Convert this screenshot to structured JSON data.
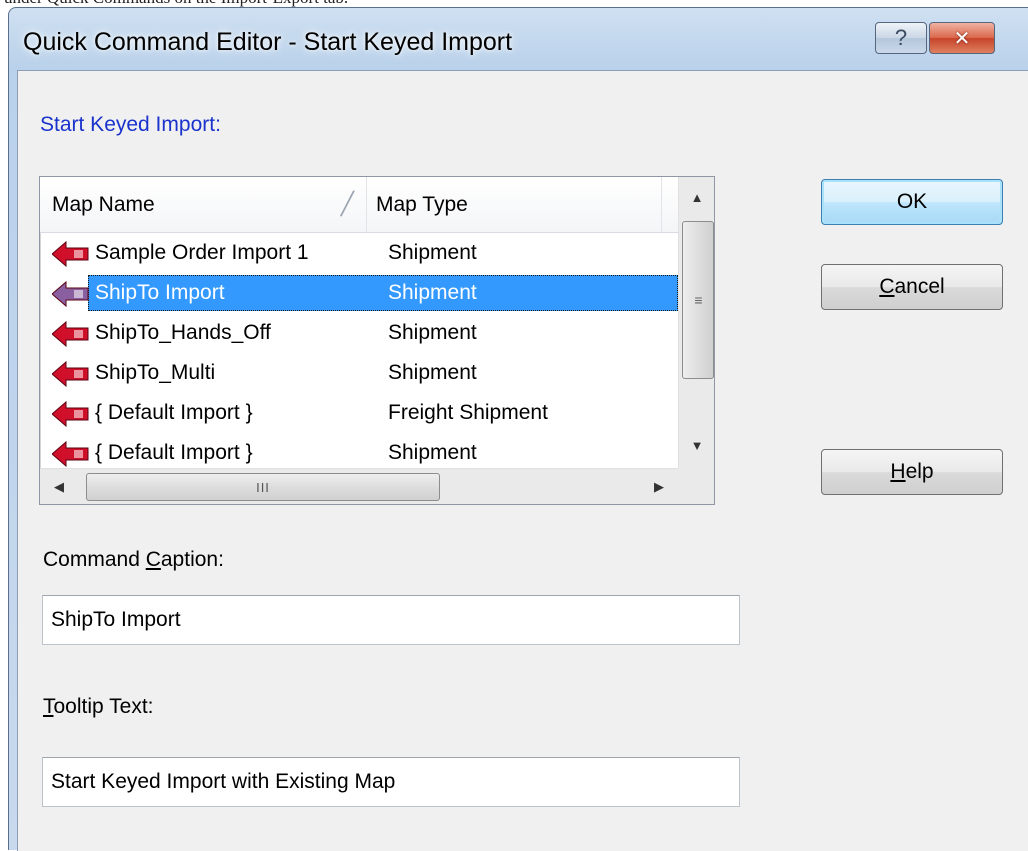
{
  "page_caption": "under Quick Commands on the Import-Export tab.",
  "window": {
    "title": "Quick Command Editor - Start Keyed Import",
    "help_glyph": "?",
    "close_glyph": "✕"
  },
  "section_label": "Start Keyed Import:",
  "list": {
    "headers": {
      "name": "Map Name",
      "type": "Map Type"
    },
    "rows": [
      {
        "name": "Sample Order Import 1",
        "type": "Shipment",
        "icon": "import-map-icon",
        "selected": false
      },
      {
        "name": "ShipTo Import",
        "type": "Shipment",
        "icon": "import-map-icon",
        "selected": true
      },
      {
        "name": "ShipTo_Hands_Off",
        "type": "Shipment",
        "icon": "import-map-icon",
        "selected": false
      },
      {
        "name": "ShipTo_Multi",
        "type": "Shipment",
        "icon": "import-map-icon",
        "selected": false
      },
      {
        "name": "{ Default Import }",
        "type": "Freight Shipment",
        "icon": "import-map-icon",
        "selected": false
      },
      {
        "name": "{ Default Import }",
        "type": "Shipment",
        "icon": "import-map-icon",
        "selected": false
      }
    ],
    "hscroll_grip": "III",
    "vscroll_grip": "≡"
  },
  "buttons": {
    "ok": "OK",
    "cancel": {
      "mnemonic": "C",
      "rest": "ancel"
    },
    "help": {
      "mnemonic": "H",
      "rest": "elp"
    }
  },
  "command_caption": {
    "label_pre": "Command ",
    "label_mnemonic": "C",
    "label_post": "aption:",
    "value": "ShipTo Import"
  },
  "tooltip_text": {
    "label_mnemonic": "T",
    "label_post": "ooltip Text:",
    "value": "Start Keyed Import with Existing Map"
  },
  "colors": {
    "selection": "#3399ff",
    "section_label": "#1a33cc",
    "icon_red": "#d0102a",
    "icon_selected": "#8a5fa0"
  }
}
